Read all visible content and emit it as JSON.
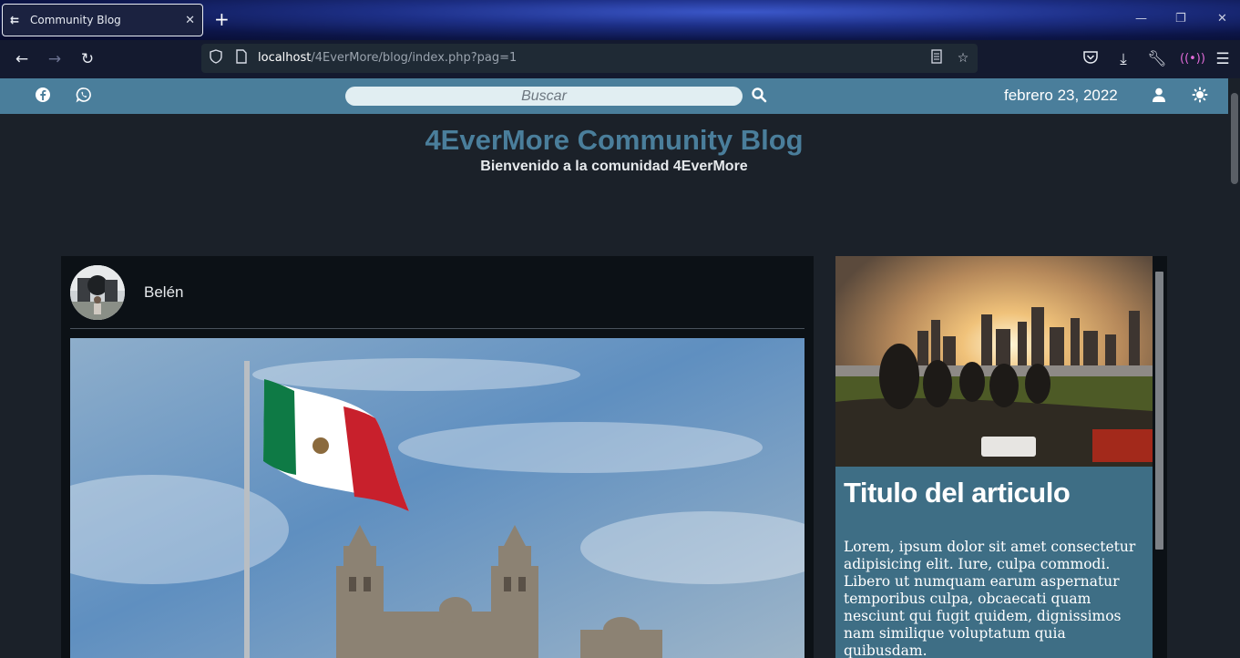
{
  "browser": {
    "tab_title": "Community Blog",
    "url_host": "localhost",
    "url_path": "/4EverMore/blog/index.php?pag=1"
  },
  "topbar": {
    "search_placeholder": "Buscar",
    "date": "febrero 23, 2022"
  },
  "header": {
    "title": "4EverMore Community Blog",
    "subtitle": "Bienvenido a la comunidad 4EverMore"
  },
  "post": {
    "author": "Belén"
  },
  "sidebar": {
    "article_title": "Titulo del articulo",
    "article_text": "Lorem, ipsum dolor sit amet consectetur adipisicing elit. Iure, culpa commodi. Libero ut numquam earum aspernatur temporibus culpa, obcaecati quam nesciunt qui fugit quidem, dignissimos nam similique voluptatum quia quibusdam."
  },
  "colors": {
    "accent": "#4a7e9b",
    "page_bg": "#1b2129",
    "card_bg": "#0c1116",
    "article_bg": "#3e6e85"
  }
}
